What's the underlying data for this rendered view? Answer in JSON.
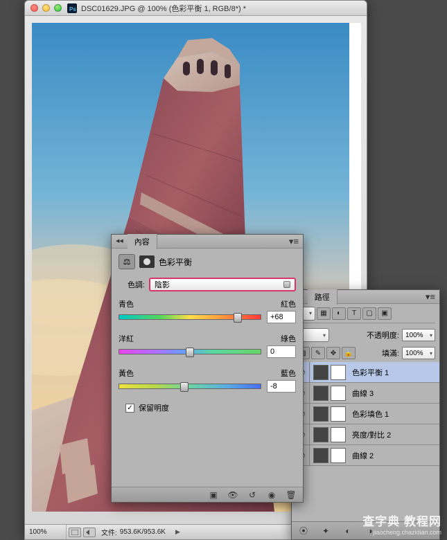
{
  "window": {
    "title": "DSC01629.JPG @ 100% (色彩平衡 1, RGB/8*) *"
  },
  "status": {
    "zoom": "100%",
    "size_label": "文件:",
    "size_value": "953.6K/953.6K"
  },
  "properties": {
    "panel_title": "內容",
    "adjustment_name": "色彩平衡",
    "tone_label": "色調:",
    "tone_value": "陰影",
    "sliders": [
      {
        "left": "青色",
        "right": "紅色",
        "value": "+68",
        "pos": 84,
        "track": "cyan-red"
      },
      {
        "left": "洋紅",
        "right": "綠色",
        "value": "0",
        "pos": 50,
        "track": "mag-green"
      },
      {
        "left": "黃色",
        "right": "藍色",
        "value": "-8",
        "pos": 46,
        "track": "yel-blue"
      }
    ],
    "preserve_label": "保留明度",
    "preserve_checked": "✓"
  },
  "layers": {
    "panel_title": "路徑",
    "opacity_label": "不透明度:",
    "opacity_value": "100%",
    "fill_label": "填滿:",
    "fill_value": "100%",
    "items": [
      {
        "name": "色彩平衡 1",
        "selected": true
      },
      {
        "name": "曲線 3",
        "selected": false
      },
      {
        "name": "色彩填色 1",
        "selected": false
      },
      {
        "name": "亮度/對比 2",
        "selected": false
      },
      {
        "name": "曲線 2",
        "selected": false
      }
    ]
  },
  "watermark": {
    "main": "查字典 教程网",
    "sub": "jiaocheng.chazidian.com"
  }
}
